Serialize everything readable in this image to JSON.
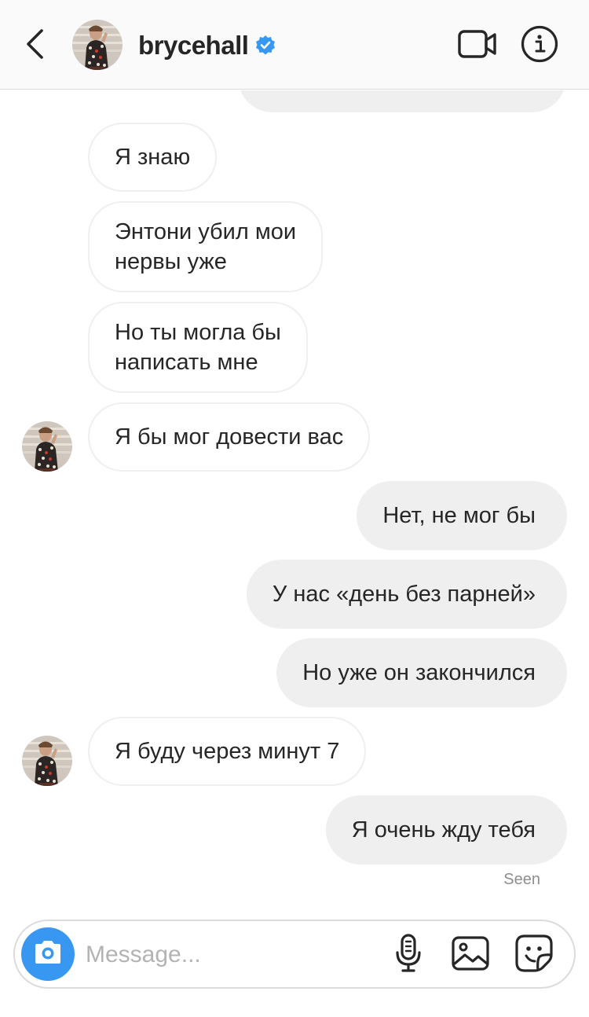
{
  "header": {
    "username": "brycehall",
    "verified": true,
    "icons": [
      "chevron-left-icon",
      "verified-badge-icon",
      "video-camera-icon",
      "info-icon"
    ]
  },
  "messages": [
    {
      "id": "m1",
      "direction": "received",
      "lines": [
        "Я знаю"
      ]
    },
    {
      "id": "m2",
      "direction": "received",
      "lines": [
        "Энтони убил мои",
        "нервы уже"
      ]
    },
    {
      "id": "m3",
      "direction": "received",
      "lines": [
        "Но ты могла бы",
        "написать мне"
      ]
    },
    {
      "id": "m4",
      "direction": "received",
      "lines": [
        "Я бы мог довести вас"
      ],
      "avatar": true
    },
    {
      "id": "m5",
      "direction": "sent",
      "lines": [
        "Нет, не мог бы"
      ]
    },
    {
      "id": "m6",
      "direction": "sent",
      "lines": [
        "У нас «день без парней»"
      ]
    },
    {
      "id": "m7",
      "direction": "sent",
      "lines": [
        "Но уже он закончился"
      ]
    },
    {
      "id": "m8",
      "direction": "received",
      "lines": [
        "Я буду через минут 7"
      ],
      "avatar": true
    },
    {
      "id": "m9",
      "direction": "sent",
      "lines": [
        "Я очень жду тебя"
      ]
    }
  ],
  "status": {
    "seen": "Seen"
  },
  "composer": {
    "placeholder": "Message...",
    "icons": [
      "camera-icon",
      "microphone-icon",
      "gallery-icon",
      "sticker-icon"
    ]
  },
  "colors": {
    "header_bg": "#fafafa",
    "sent_bubble": "#efefef",
    "received_border": "#efefef",
    "accent_blue": "#3897f0",
    "text": "#262626",
    "muted": "#8e8e8e"
  }
}
